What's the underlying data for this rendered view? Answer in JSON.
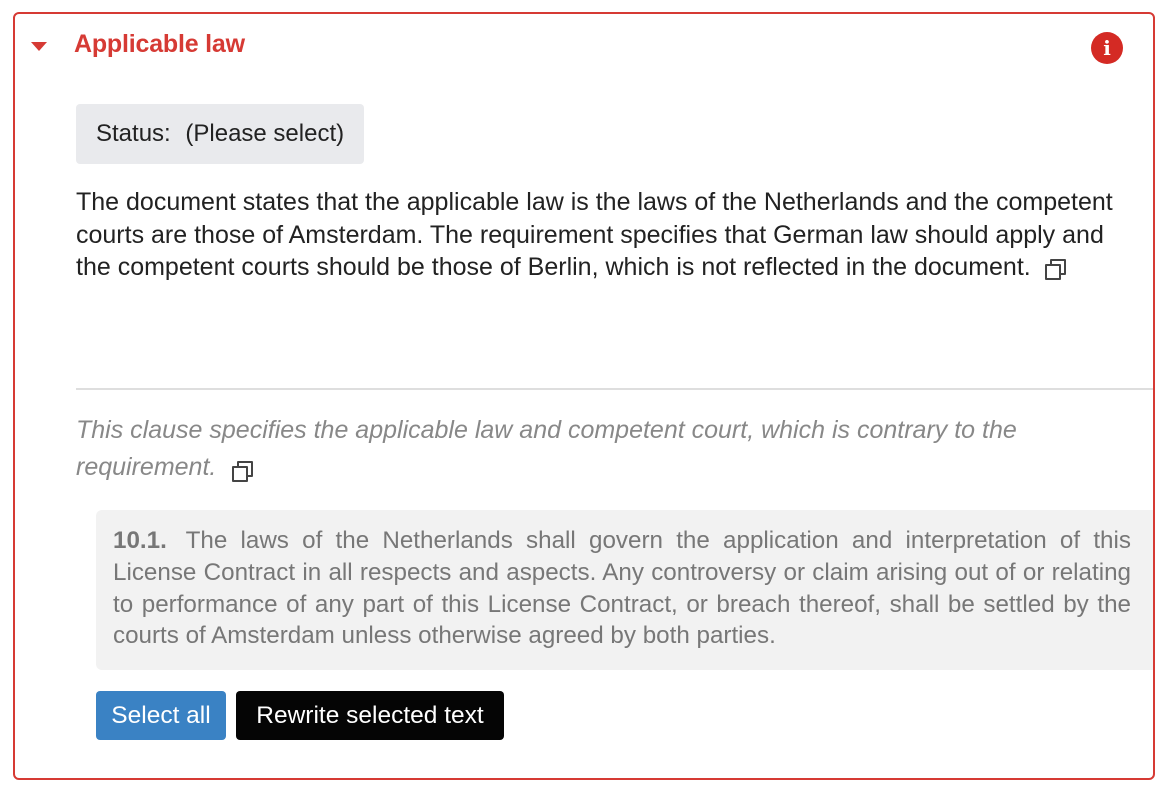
{
  "section": {
    "title": "Applicable law",
    "status_label": "Status:",
    "status_value": "(Please select)",
    "summary": "The document states that the applicable law is the laws of the Netherlands and the competent courts are those of Amsterdam. The requirement specifies that German law should apply and the competent courts should be those of Berlin, which is not reflected in the document.",
    "reason": "This clause specifies the applicable law and competent court, which is contrary to the requirement.",
    "clause": {
      "number": "10.1.",
      "text": "The laws of the Netherlands shall govern the application and interpretation of this License Contract in all respects and aspects. Any controversy or claim arising out of or relating to performance of any part of this License Contract, or breach thereof, shall be settled by the courts of Amsterdam unless otherwise agreed by both parties."
    },
    "buttons": {
      "select_all": "Select all",
      "rewrite": "Rewrite selected text"
    }
  },
  "icons": {
    "collapse": "caret-down-icon",
    "info": "info-icon",
    "copy": "copy-icon"
  },
  "colors": {
    "accent": "#d63a34",
    "info_badge": "#d42a24",
    "primary_button": "#3a82c4",
    "dark_button": "#050505"
  }
}
